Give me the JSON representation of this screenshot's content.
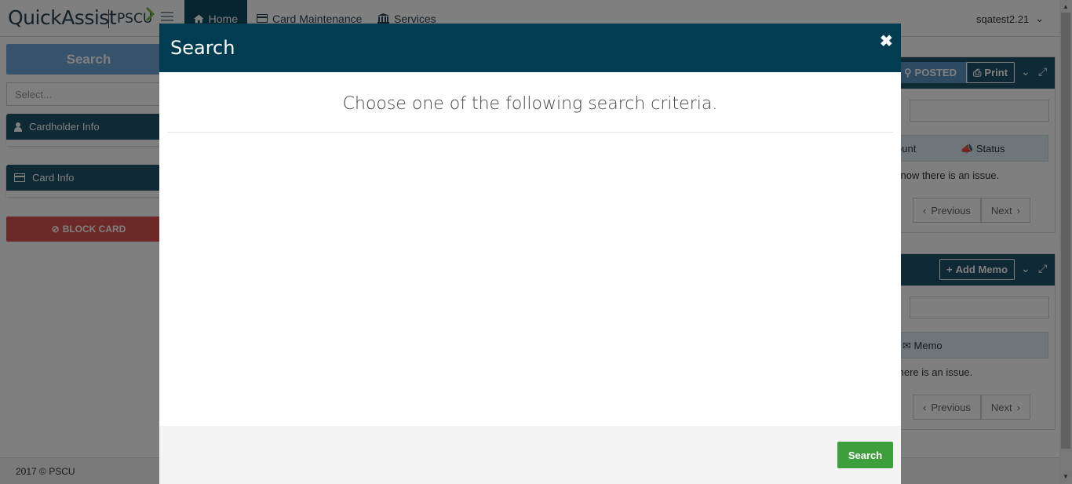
{
  "navbar": {
    "brand": "QuickAssist",
    "brand_sub": "PSCU",
    "items": [
      {
        "label": "Home",
        "active": true
      },
      {
        "label": "Card Maintenance",
        "active": false
      },
      {
        "label": "Services",
        "active": false
      }
    ],
    "user": "sqatest2.21"
  },
  "sidebar": {
    "search_label": "Search",
    "select_placeholder": "Select...",
    "panels": [
      {
        "label": "Cardholder Info"
      },
      {
        "label": "Card Info"
      }
    ],
    "block_card_label": "BLOCK CARD"
  },
  "right_panels": {
    "top": {
      "posted_label": "POSTED",
      "print_label": "Print",
      "filter_label": ":",
      "columns": [
        "ount",
        "Status"
      ],
      "row_text": "know there is an issue.",
      "previous_label": "Previous",
      "next_label": "Next"
    },
    "bottom": {
      "add_memo_label": "Add Memo",
      "filter_label": ":",
      "columns": [
        "Memo"
      ],
      "row_text": "there is an issue.",
      "previous_label": "Previous",
      "next_label": "Next"
    }
  },
  "footer": {
    "text": "2017 © PSCU"
  },
  "modal": {
    "title": "Search",
    "heading": "Choose one of the following search criteria.",
    "search_button": "Search"
  },
  "colors": {
    "modal_header": "#003d52",
    "primary_nav": "#0e4b63",
    "panel_header": "#1f5568",
    "search_button": "#3c9f3c",
    "block_card": "#d9534f",
    "sidebar_search": "#6fa6d6"
  }
}
